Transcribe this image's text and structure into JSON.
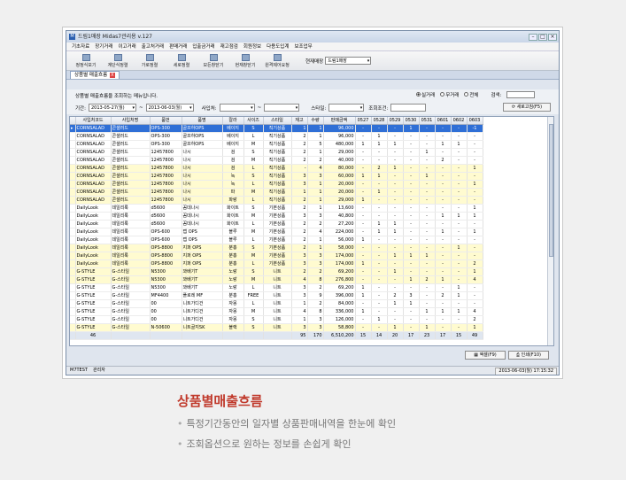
{
  "window": {
    "title": "드림1매장 Midas7관리용 v.127"
  },
  "menu": [
    "기초자료",
    "장기거래",
    "이고거래",
    "출고처거래",
    "판매거래",
    "입출금거래",
    "재고점검",
    "회원정보",
    "다용도입계",
    "보조업무"
  ],
  "toolbar": {
    "buttons": [
      "정정식보기",
      "계단식정렬",
      "가로정렬",
      "세로정렬",
      "모든창닫기",
      "현재창닫기",
      "원격제어요청"
    ],
    "store_label": "현재매장",
    "store_value": "드림1매장"
  },
  "tab": {
    "label": "상품별 매출흐름",
    "close": "X"
  },
  "filter": {
    "description": "상품별 매출흐름을 조회하는 메뉴입니다.",
    "radios": [
      {
        "label": "실거래",
        "selected": true
      },
      {
        "label": "무거래",
        "selected": false
      },
      {
        "label": "전체",
        "selected": false
      }
    ],
    "search_label": "검색:",
    "period_label": "기간:",
    "date_from": "2013-05-27(월)",
    "date_sep": "~",
    "date_to": "2013-06-03(월)",
    "buyer_label": "사입처:",
    "buyer_sep": "~",
    "style_label": "스타일:",
    "cond_label": "조회조건:",
    "new_button": "새로고침(F5)"
  },
  "table": {
    "columns": [
      "사입처코드",
      "사입처명",
      "품번",
      "품명",
      "칼라",
      "사이즈",
      "스타일",
      "재고",
      "수량",
      "판매금액",
      "0527",
      "0528",
      "0529",
      "0530",
      "0531",
      "0601",
      "0602",
      "0603"
    ],
    "rows": [
      {
        "hl": "sel",
        "c": [
          "CORNSALAD",
          "콘샐러드",
          "OPS-300",
          "골프하OPS",
          "베이지",
          "S",
          "직기상품",
          "1",
          "1",
          "96,000",
          "-",
          "-",
          "-",
          "1",
          "-",
          "-",
          "-",
          "-1"
        ]
      },
      {
        "hl": "",
        "c": [
          "CORNSALAD",
          "콘샐러드",
          "OPS-300",
          "골프하OPS",
          "베이지",
          "L",
          "직기상품",
          "2",
          "1",
          "96,000",
          "-",
          "1",
          "-",
          "-",
          "-",
          "-",
          "-",
          "-"
        ]
      },
      {
        "hl": "",
        "c": [
          "CORNSALAD",
          "콘샐러드",
          "OPS-300",
          "골프하OPS",
          "베이지",
          "M",
          "직기상품",
          "2",
          "5",
          "480,000",
          "1",
          "1",
          "1",
          "-",
          "-",
          "1",
          "1",
          "-"
        ]
      },
      {
        "hl": "",
        "c": [
          "CORNSALAD",
          "콘샐러드",
          "12457800",
          "나시",
          "검",
          "S",
          "직기상품",
          "2",
          "1",
          "29,000",
          "-",
          "-",
          "-",
          "-",
          "1",
          "-",
          "-",
          "-"
        ]
      },
      {
        "hl": "",
        "c": [
          "CORNSALAD",
          "콘샐러드",
          "12457800",
          "나시",
          "검",
          "M",
          "직기상품",
          "2",
          "2",
          "40,000",
          "-",
          "-",
          "-",
          "-",
          "-",
          "2",
          "-",
          "-"
        ]
      },
      {
        "hl": "yel",
        "c": [
          "CORNSALAD",
          "콘샐러드",
          "12457800",
          "나시",
          "검",
          "L",
          "직기상품",
          "-",
          "4",
          "80,000",
          "-",
          "2",
          "1",
          "-",
          "-",
          "-",
          "-",
          "1"
        ]
      },
      {
        "hl": "yel",
        "c": [
          "CORNSALAD",
          "콘샐러드",
          "12457800",
          "나시",
          "녹",
          "S",
          "직기상품",
          "3",
          "3",
          "60,000",
          "1",
          "1",
          "-",
          "-",
          "1",
          "-",
          "-",
          "-"
        ]
      },
      {
        "hl": "yel",
        "c": [
          "CORNSALAD",
          "콘샐러드",
          "12457800",
          "나시",
          "녹",
          "L",
          "직기상품",
          "3",
          "1",
          "20,000",
          "-",
          "-",
          "-",
          "-",
          "-",
          "-",
          "-",
          "1"
        ]
      },
      {
        "hl": "yel",
        "c": [
          "CORNSALAD",
          "콘샐러드",
          "12457800",
          "나시",
          "파",
          "M",
          "직기상품",
          "1",
          "1",
          "20,000",
          "-",
          "1",
          "-",
          "-",
          "-",
          "-",
          "-",
          "-"
        ]
      },
      {
        "hl": "yel",
        "c": [
          "CORNSALAD",
          "콘샐러드",
          "12457800",
          "나시",
          "파랑",
          "L",
          "직기상품",
          "2",
          "1",
          "29,000",
          "1",
          "-",
          "-",
          "-",
          "-",
          "-",
          "-",
          "-"
        ]
      },
      {
        "hl": "",
        "c": [
          "DailyLook",
          "데일리룩",
          "d5600",
          "꼼데나시",
          "화이트",
          "S",
          "기본상품",
          "2",
          "1",
          "13,600",
          "-",
          "-",
          "-",
          "-",
          "-",
          "-",
          "-",
          "1"
        ]
      },
      {
        "hl": "",
        "c": [
          "DailyLook",
          "데일리룩",
          "d5600",
          "꼼데나시",
          "화이트",
          "M",
          "기본상품",
          "3",
          "3",
          "40,800",
          "-",
          "-",
          "-",
          "-",
          "-",
          "1",
          "1",
          "1"
        ]
      },
      {
        "hl": "",
        "c": [
          "DailyLook",
          "데일리룩",
          "d5600",
          "꼼데나시",
          "화이트",
          "L",
          "기본상품",
          "2",
          "2",
          "27,200",
          "-",
          "1",
          "1",
          "-",
          "-",
          "-",
          "-",
          "-"
        ]
      },
      {
        "hl": "",
        "c": [
          "DailyLook",
          "데일리룩",
          "OPS-600",
          "랩 OPS",
          "블루",
          "M",
          "기본상품",
          "2",
          "4",
          "224,000",
          "-",
          "1",
          "1",
          "-",
          "-",
          "1",
          "-",
          "1"
        ]
      },
      {
        "hl": "",
        "c": [
          "DailyLook",
          "데일리룩",
          "OPS-600",
          "랩 OPS",
          "블루",
          "L",
          "기본상품",
          "2",
          "1",
          "56,000",
          "1",
          "-",
          "-",
          "-",
          "-",
          "-",
          "-",
          "-"
        ]
      },
      {
        "hl": "yel",
        "c": [
          "DailyLook",
          "데일리룩",
          "OPS-8800",
          "지퍼 OPS",
          "분홍",
          "S",
          "기본상품",
          "2",
          "1",
          "58,000",
          "-",
          "-",
          "-",
          "-",
          "-",
          "-",
          "1",
          "-"
        ]
      },
      {
        "hl": "yel",
        "c": [
          "DailyLook",
          "데일리룩",
          "OPS-8800",
          "지퍼 OPS",
          "분홍",
          "M",
          "기본상품",
          "3",
          "3",
          "174,000",
          "-",
          "-",
          "1",
          "1",
          "1",
          "-",
          "-",
          "-"
        ]
      },
      {
        "hl": "yel",
        "c": [
          "DailyLook",
          "데일리룩",
          "OPS-8800",
          "지퍼 OPS",
          "분홍",
          "L",
          "기본상품",
          "3",
          "3",
          "174,000",
          "1",
          "-",
          "-",
          "-",
          "-",
          "-",
          "-",
          "2"
        ]
      },
      {
        "hl": "yel",
        "c": [
          "G-STYLE",
          "G-스타일",
          "N5300",
          "꽈배기T",
          "노랑",
          "S",
          "니트",
          "2",
          "2",
          "69,200",
          "-",
          "-",
          "1",
          "-",
          "-",
          "-",
          "-",
          "1"
        ]
      },
      {
        "hl": "yel",
        "c": [
          "G-STYLE",
          "G-스타일",
          "N5300",
          "꽈배기T",
          "노랑",
          "M",
          "니트",
          "4",
          "8",
          "276,800",
          "-",
          "-",
          "-",
          "1",
          "2",
          "1",
          "-",
          "4"
        ]
      },
      {
        "hl": "",
        "c": [
          "G-STYLE",
          "G-스타일",
          "N5300",
          "꽈배기T",
          "노랑",
          "L",
          "니트",
          "3",
          "2",
          "69,200",
          "1",
          "-",
          "-",
          "-",
          "-",
          "-",
          "1",
          "-"
        ]
      },
      {
        "hl": "",
        "c": [
          "G-STYLE",
          "G-스타일",
          "MF4400",
          "플로레 MF",
          "분홍",
          "FREE",
          "니트",
          "3",
          "9",
          "396,000",
          "1",
          "-",
          "2",
          "3",
          "-",
          "2",
          "1",
          "-"
        ]
      },
      {
        "hl": "",
        "c": [
          "G-STYLE",
          "G-스타일",
          "00",
          "니트가디건",
          "자몽",
          "L",
          "니트",
          "1",
          "2",
          "84,000",
          "-",
          "-",
          "1",
          "1",
          "-",
          "-",
          "-",
          "-"
        ]
      },
      {
        "hl": "",
        "c": [
          "G-STYLE",
          "G-스타일",
          "00",
          "니트가디건",
          "자몽",
          "M",
          "니트",
          "4",
          "8",
          "336,000",
          "1",
          "-",
          "-",
          "-",
          "1",
          "1",
          "1",
          "4"
        ]
      },
      {
        "hl": "",
        "c": [
          "G-STYLE",
          "G-스타일",
          "00",
          "니트가디건",
          "자몽",
          "S",
          "니트",
          "1",
          "3",
          "126,000",
          "-",
          "1",
          "-",
          "-",
          "-",
          "-",
          "-",
          "2"
        ]
      },
      {
        "hl": "yel",
        "c": [
          "G-STYLE",
          "G-스타일",
          "N-50600",
          "니트골지SK",
          "블랙",
          "S",
          "니트",
          "3",
          "3",
          "58,800",
          "-",
          "-",
          "1",
          "-",
          "1",
          "-",
          "-",
          "1"
        ]
      }
    ],
    "totals": [
      "46",
      "",
      "",
      "",
      "",
      "",
      "",
      "95",
      "170",
      "6,510,200",
      "15",
      "14",
      "20",
      "17",
      "23",
      "17",
      "15",
      "49"
    ]
  },
  "buttons": {
    "excel": "엑셀(F9)",
    "print": "인쇄(F10)"
  },
  "status": {
    "user": "M7TEST",
    "role": "관리자",
    "datetime": "2013-06-03(월) 17:15:32"
  },
  "caption": {
    "title": "상품별매출흐름",
    "lines": [
      "특정기간동안의 일자별 상품판매내역을 한눈에 확인",
      "조회옵션으로 원하는 정보를 손쉽게 확인"
    ]
  },
  "colors": {
    "selected_row": "#2f6fd6",
    "highlight_row": "#fffbd0",
    "caption_title": "#c0392b"
  }
}
